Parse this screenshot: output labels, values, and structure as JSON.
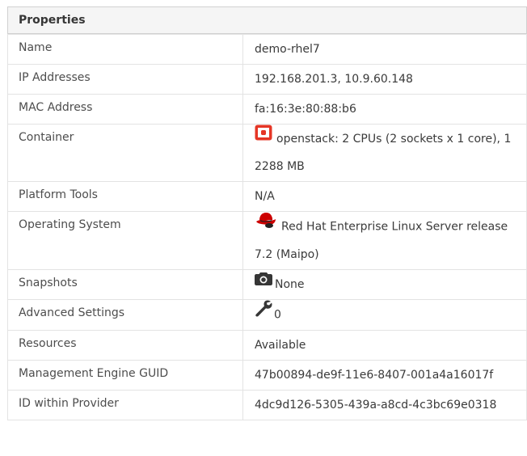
{
  "panel": {
    "title": "Properties"
  },
  "rows": [
    {
      "label": "Name",
      "value": "demo-rhel7"
    },
    {
      "label": "IP Addresses",
      "value": "192.168.201.3, 10.9.60.148"
    },
    {
      "label": "MAC Address",
      "value": "fa:16:3e:80:88:b6"
    },
    {
      "label": "Container",
      "value": "openstack: 2 CPUs (2 sockets x 1 core), 12288 MB",
      "icon": "openstack-icon"
    },
    {
      "label": "Platform Tools",
      "value": "N/A"
    },
    {
      "label": "Operating System",
      "value": "Red Hat Enterprise Linux Server release 7.2 (Maipo)",
      "icon": "redhat-icon"
    },
    {
      "label": "Snapshots",
      "value": "None",
      "icon": "camera-icon"
    },
    {
      "label": "Advanced Settings",
      "value": "0",
      "icon": "wrench-icon"
    },
    {
      "label": "Resources",
      "value": "Available"
    },
    {
      "label": "Management Engine GUID",
      "value": "47b00894-de9f-11e6-8407-001a4a16017f"
    },
    {
      "label": "ID within Provider",
      "value": "4dc9d126-5305-439a-a8cd-4c3bc69e0318"
    }
  ],
  "colors": {
    "openstack_red": "#e53626",
    "redhat_red": "#cc0000",
    "icon_dark": "#363636",
    "header_bg": "#f5f5f5",
    "border": "#e3e3e3"
  }
}
